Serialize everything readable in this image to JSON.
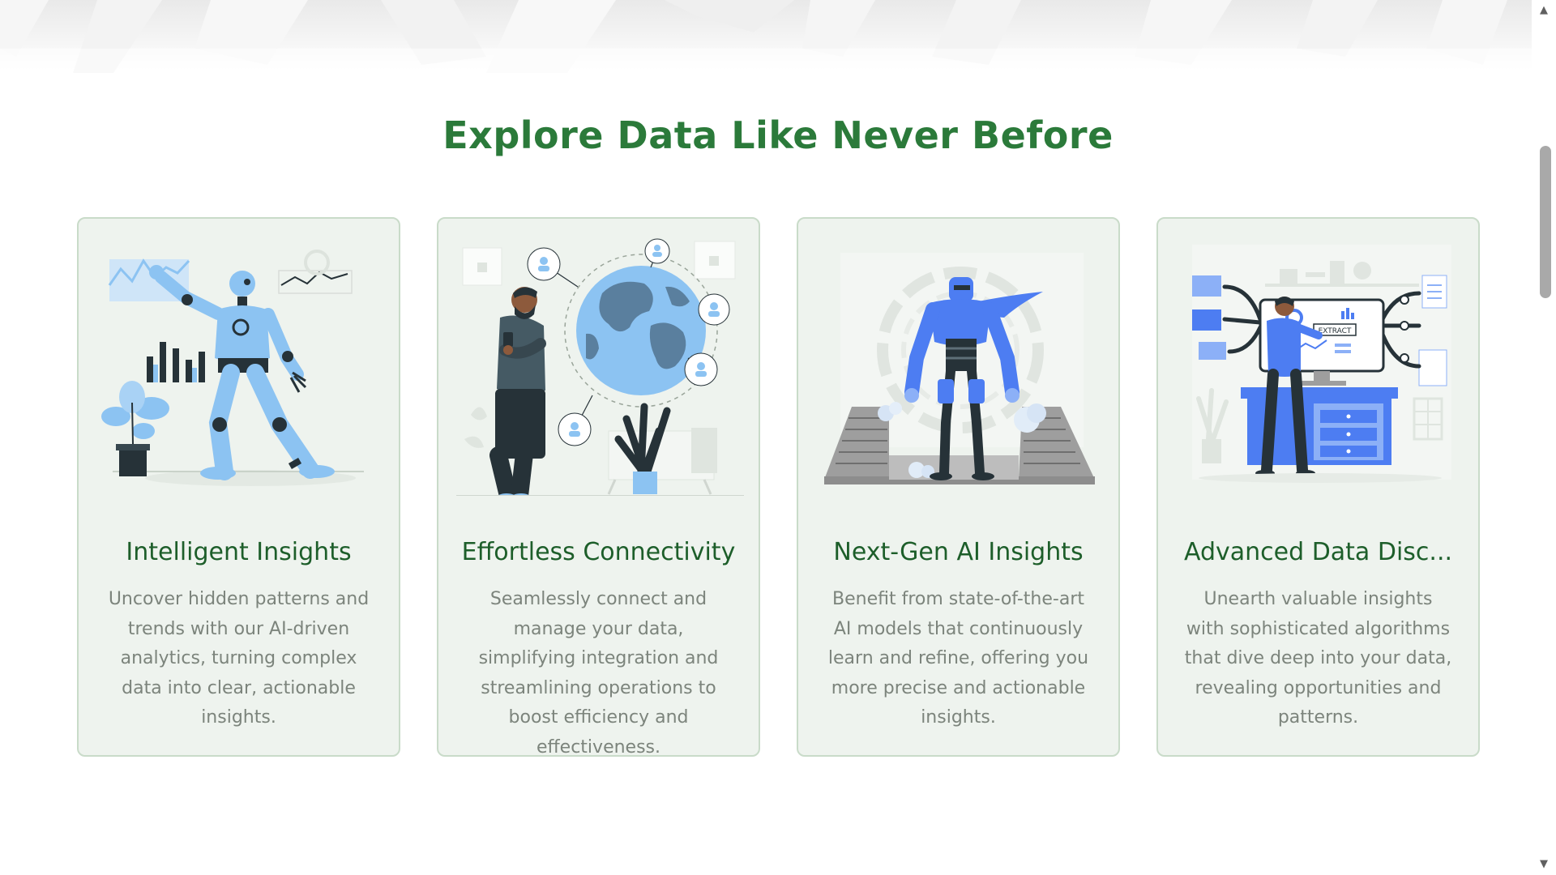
{
  "section": {
    "title": "Explore Data Like Never Before"
  },
  "cards": [
    {
      "title": "Intelligent Insights",
      "description": "Uncover hidden patterns and trends with our AI-driven analytics, turning complex data into clear, actionable insights.",
      "illustration": "robot-analytics-illustration"
    },
    {
      "title": "Effortless Connectivity",
      "description": "Seamlessly connect and manage your data, simplifying integration and streamlining operations to boost efficiency and effectiveness.",
      "illustration": "globe-connectivity-illustration"
    },
    {
      "title": "Next-Gen AI Insights",
      "description": "Benefit from state-of-the-art AI models that continuously learn and refine, offering you more precise and actionable insights.",
      "illustration": "hero-robot-illustration"
    },
    {
      "title": "Advanced Data Disc...",
      "description": "Unearth valuable insights with sophisticated algorithms that dive deep into your data, revealing opportunities and patterns.",
      "illustration": "data-extract-illustration"
    }
  ],
  "illustration_texts": {
    "extract_label": "EXTRACT"
  },
  "colors": {
    "title_green": "#2b7a3a",
    "card_title_green": "#1d5e2a",
    "card_bg": "#eef3ee",
    "card_border": "#c9dbc9",
    "body_text": "#7c847c",
    "illus_blue": "#8cc3f2",
    "illus_dark": "#263238"
  },
  "scrollbar": {
    "up_icon": "▲",
    "down_icon": "▼"
  }
}
